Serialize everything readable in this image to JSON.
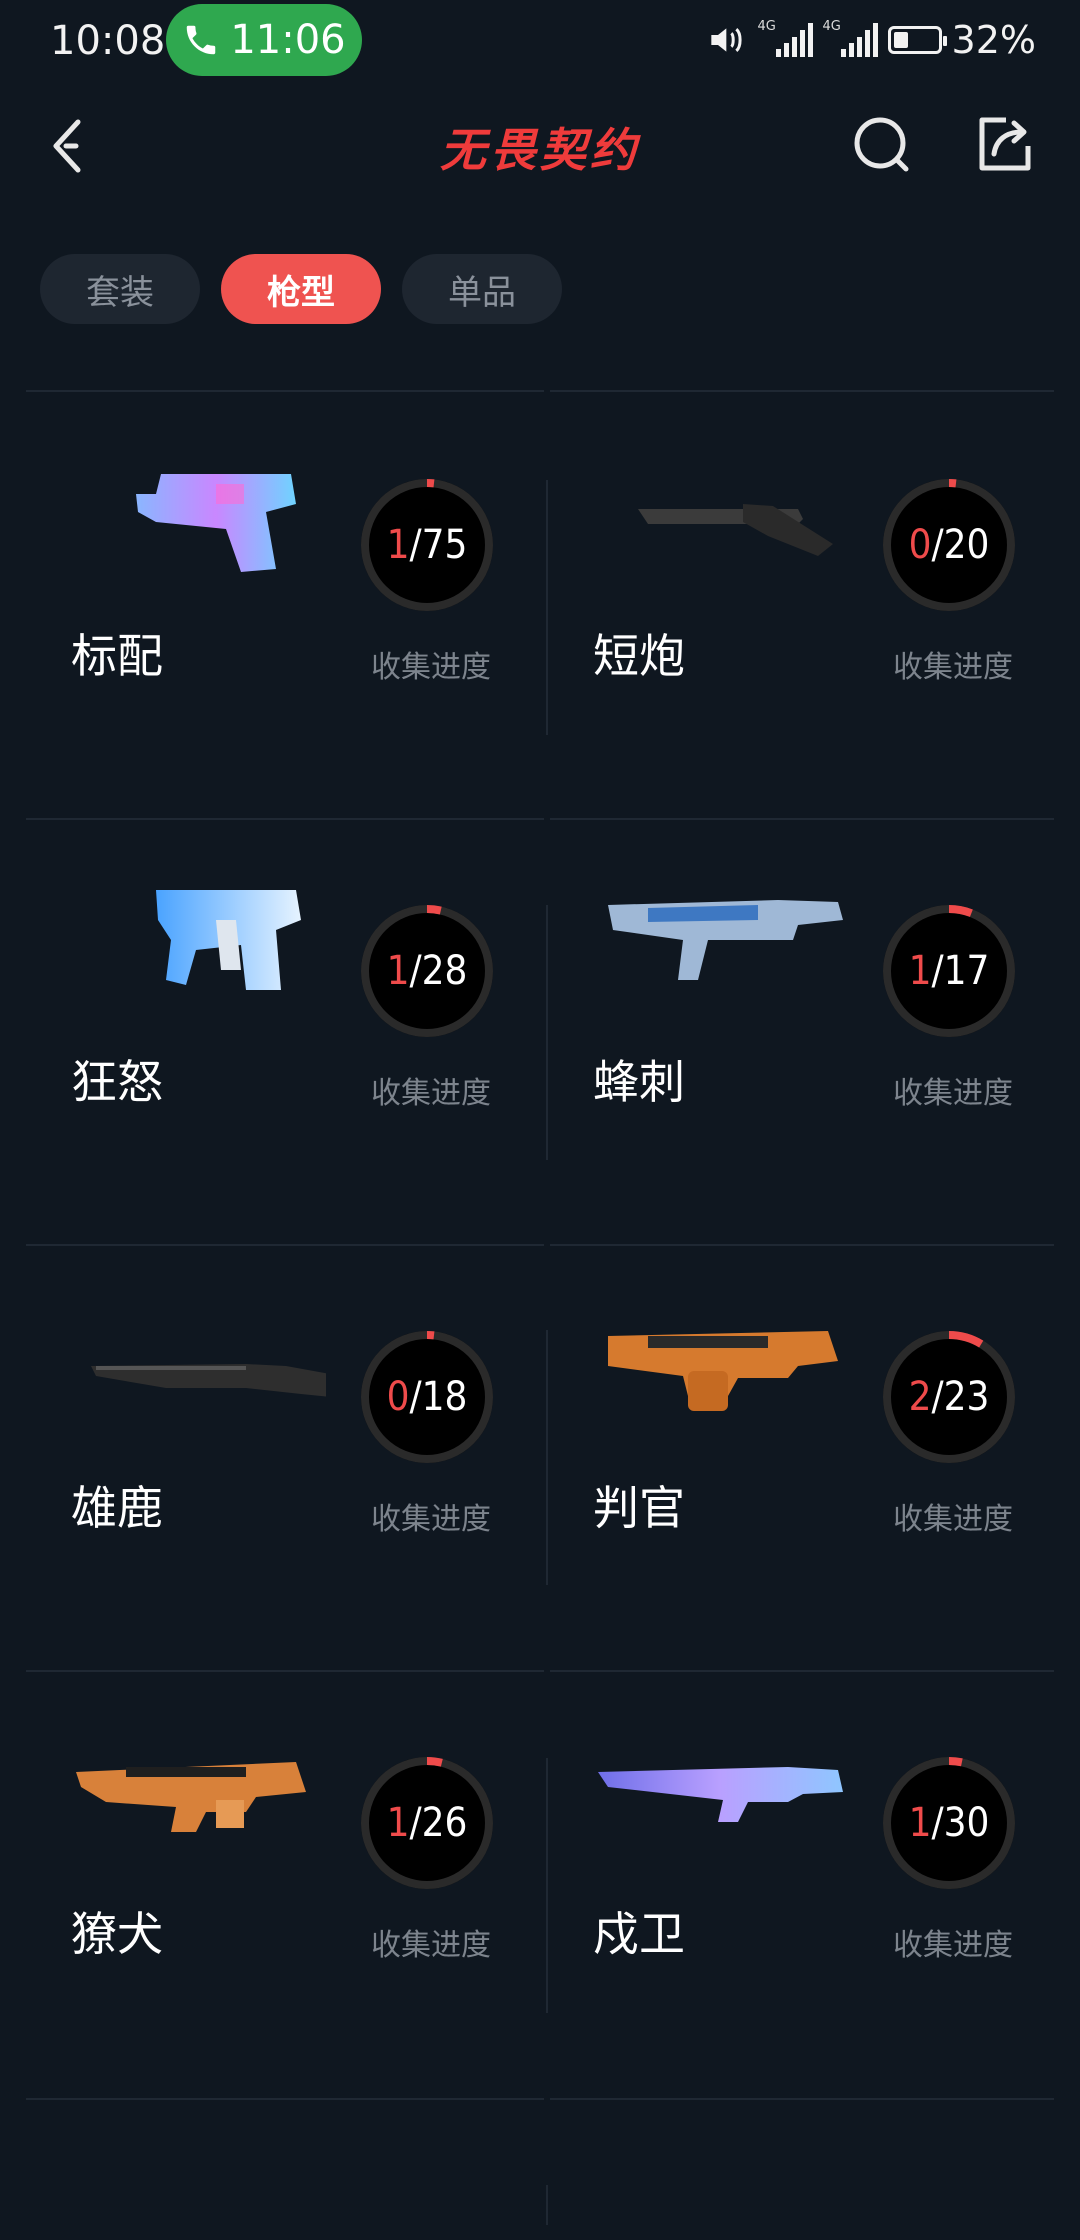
{
  "status_bar": {
    "time": "10:08",
    "call_timer": "11:06",
    "network_tag_1": "4G",
    "network_tag_2": "4G",
    "battery": "32%"
  },
  "header": {
    "logo_text": "无畏契约",
    "icons": [
      "back-icon",
      "search-icon",
      "share-icon"
    ]
  },
  "tabs": [
    {
      "label": "套装",
      "active": false
    },
    {
      "label": "枪型",
      "active": true
    },
    {
      "label": "单品",
      "active": false
    }
  ],
  "colors": {
    "background": "#0f1720",
    "accent": "#ef5350",
    "call_green": "#2fa84f",
    "ring_track": "#2a2a2a",
    "progress_red": "#ef4b4b"
  },
  "weapons": [
    {
      "name": "标配",
      "owned": "1",
      "total": "75",
      "label": "收集进度",
      "fraction": 0.0133
    },
    {
      "name": "短炮",
      "owned": "0",
      "total": "20",
      "label": "收集进度",
      "fraction": 0.0
    },
    {
      "name": "狂怒",
      "owned": "1",
      "total": "28",
      "label": "收集进度",
      "fraction": 0.0357
    },
    {
      "name": "蜂刺",
      "owned": "1",
      "total": "17",
      "label": "收集进度",
      "fraction": 0.0588
    },
    {
      "name": "雄鹿",
      "owned": "0",
      "total": "18",
      "label": "收集进度",
      "fraction": 0.0
    },
    {
      "name": "判官",
      "owned": "2",
      "total": "23",
      "label": "收集进度",
      "fraction": 0.087
    },
    {
      "name": "獠犬",
      "owned": "1",
      "total": "26",
      "label": "收集进度",
      "fraction": 0.0385
    },
    {
      "name": "戍卫",
      "owned": "1",
      "total": "30",
      "label": "收集进度",
      "fraction": 0.0333
    }
  ]
}
